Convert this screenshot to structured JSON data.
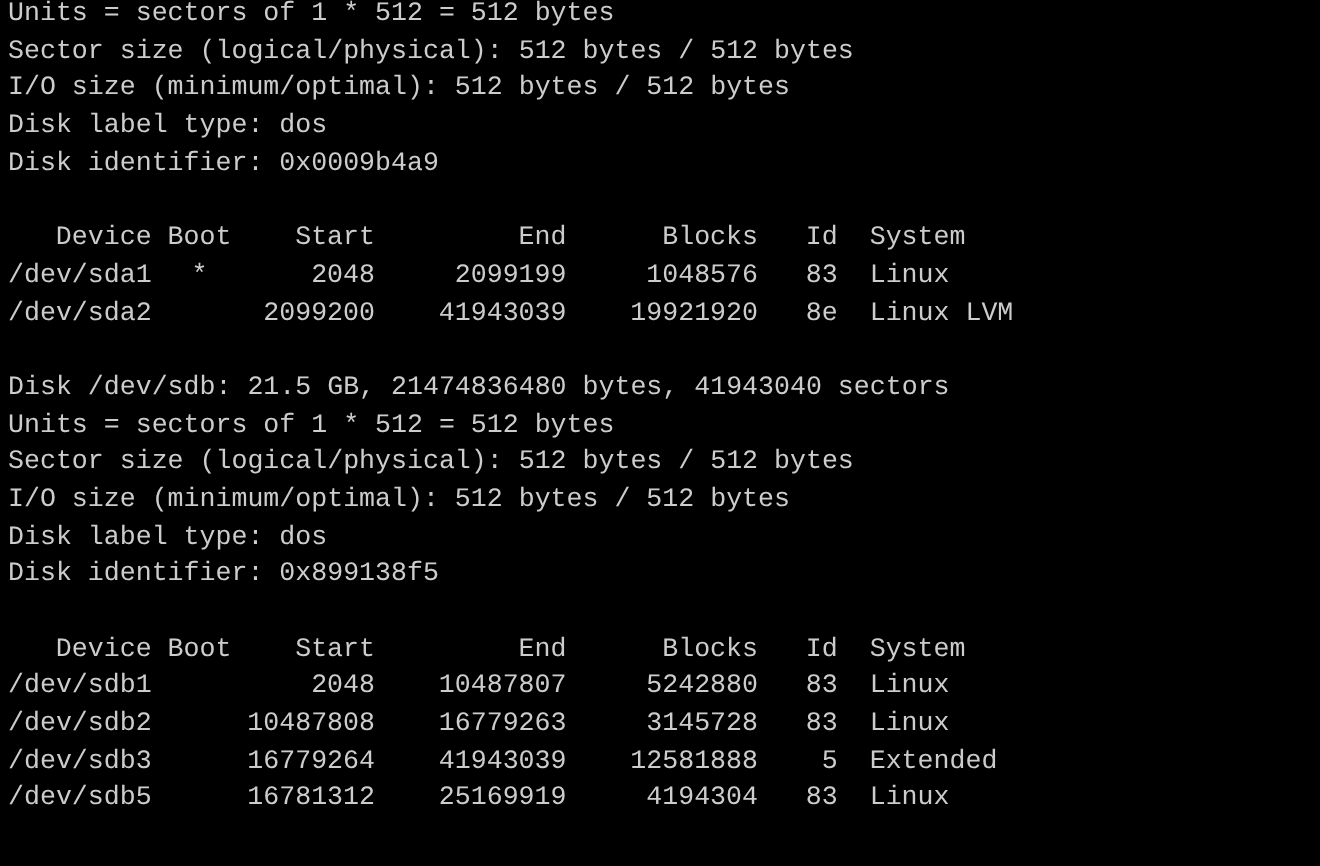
{
  "blocks": [
    {
      "kind": "info",
      "lines": [
        "Units = sectors of 1 * 512 = 512 bytes",
        "Sector size (logical/physical): 512 bytes / 512 bytes",
        "I/O size (minimum/optimal): 512 bytes / 512 bytes",
        "Disk label type: dos",
        "Disk identifier: 0x0009b4a9"
      ]
    },
    {
      "kind": "table",
      "columns": [
        "Device",
        "Boot",
        "Start",
        "End",
        "Blocks",
        "Id",
        "System"
      ],
      "rows": [
        {
          "device": "/dev/sda1",
          "boot": "*",
          "start": "2048",
          "end": "2099199",
          "blocks": "1048576",
          "id": "83",
          "system": "Linux"
        },
        {
          "device": "/dev/sda2",
          "start": "2099200",
          "end": "41943039",
          "blocks": "19921920",
          "id": "8e",
          "system": "Linux LVM"
        }
      ]
    },
    {
      "kind": "info",
      "lines": [
        "Disk /dev/sdb: 21.5 GB, 21474836480 bytes, 41943040 sectors",
        "Units = sectors of 1 * 512 = 512 bytes",
        "Sector size (logical/physical): 512 bytes / 512 bytes",
        "I/O size (minimum/optimal): 512 bytes / 512 bytes",
        "Disk label type: dos",
        "Disk identifier: 0x899138f5"
      ]
    },
    {
      "kind": "table",
      "columns": [
        "Device",
        "Boot",
        "Start",
        "End",
        "Blocks",
        "Id",
        "System"
      ],
      "rows": [
        {
          "device": "/dev/sdb1",
          "start": "2048",
          "end": "10487807",
          "blocks": "5242880",
          "id": "83",
          "system": "Linux"
        },
        {
          "device": "/dev/sdb2",
          "start": "10487808",
          "end": "16779263",
          "blocks": "3145728",
          "id": "83",
          "system": "Linux"
        },
        {
          "device": "/dev/sdb3",
          "start": "16779264",
          "end": "41943039",
          "blocks": "12581888",
          "id": "5",
          "system": "Extended"
        },
        {
          "device": "/dev/sdb5",
          "start": "16781312",
          "end": "25169919",
          "blocks": "4194304",
          "id": "83",
          "system": "Linux"
        }
      ]
    }
  ]
}
